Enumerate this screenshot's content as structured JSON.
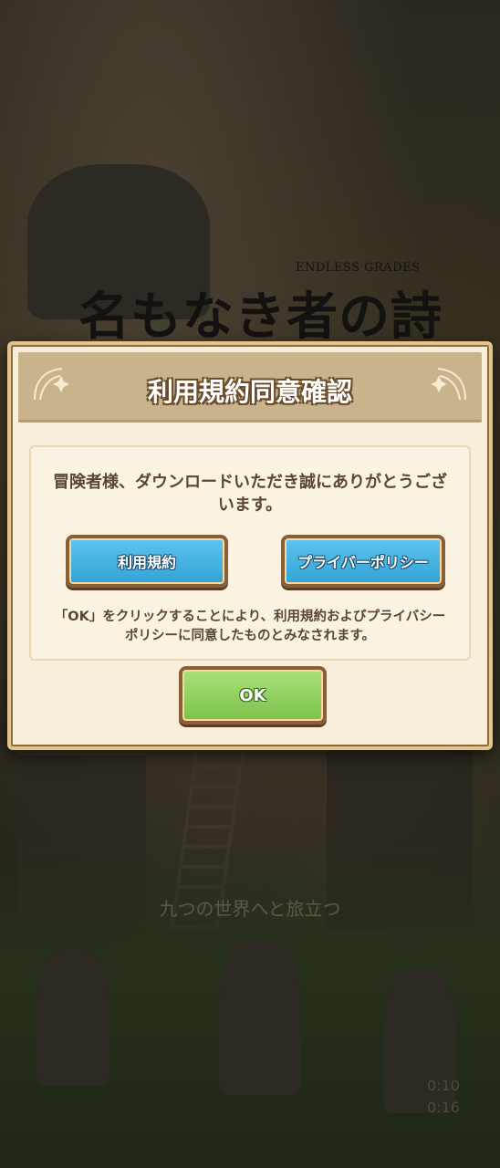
{
  "background": {
    "logo_subtitle": "ENDLESS GRADES",
    "logo_title": "名もなき者の詩",
    "tagline": "九つの世界へと旅立つ",
    "time_top": "0:10",
    "time_bottom": "0:16"
  },
  "dialog": {
    "title": "利用規約同意確認",
    "message": "冒険者様、ダウンロードいただき誠にありがとうございます。",
    "terms_button": "利用規約",
    "privacy_button": "プライバーポリシー",
    "notice": "「OK」をクリックすることにより、利用規約およびプライバシーポリシーに同意したものとみなされます。",
    "ok_button": "OK"
  }
}
